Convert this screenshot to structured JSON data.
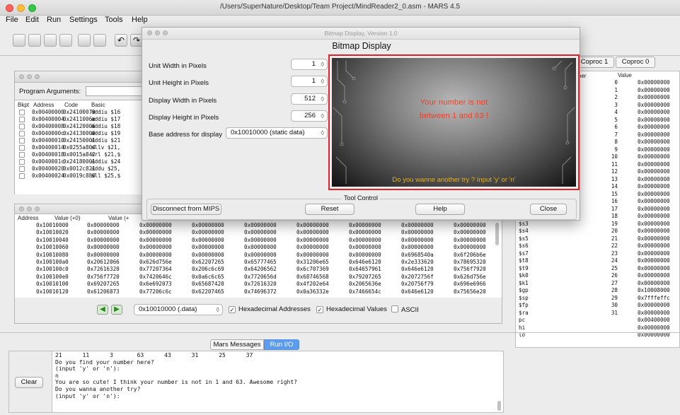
{
  "window": {
    "title": "/Users/SuperNature/Desktop/Team Project/MindReader2_0.asm - MARS 4.5"
  },
  "menu": [
    "File",
    "Edit",
    "Run",
    "Settings",
    "Tools",
    "Help"
  ],
  "bitmap": {
    "window_title": "Bitmap Display, Version 1.0",
    "heading": "Bitmap Display",
    "unit_width_label": "Unit Width in Pixels",
    "unit_width_value": "1",
    "unit_height_label": "Unit Height in Pixels",
    "unit_height_value": "1",
    "display_width_label": "Display Width in Pixels",
    "display_width_value": "512",
    "display_height_label": "Display Height in Pixels",
    "display_height_value": "256",
    "base_label": "Base address for display",
    "base_value": "0x10010000 (static data)",
    "message_line1": "Your number is not",
    "message_line2": "between 1 and 63 !",
    "prompt": "Do you wanne another try ? Input 'y' or 'n'",
    "tool_control": "Tool Control",
    "disconnect": "Disconnect from MIPS",
    "reset": "Reset",
    "help": "Help",
    "close": "Close",
    "accent_color": "#d9242a"
  },
  "text_segment": {
    "program_args_label": "Program Arguments:",
    "headers": [
      "Bkpt",
      "Address",
      "Code",
      "Basic"
    ],
    "rows": [
      [
        "0x00400000",
        "0x24100079",
        "addiu $16"
      ],
      [
        "0x00400004",
        "0x2411006e",
        "addiu $17"
      ],
      [
        "0x00400008",
        "0x24120006",
        "addiu $18"
      ],
      [
        "0x0040000c",
        "0x24130000",
        "addiu $19"
      ],
      [
        "0x00400010",
        "0x24150001",
        "addiu $21"
      ],
      [
        "0x00400014",
        "0x0255a804",
        "sllv $21,"
      ],
      [
        "0x00400018",
        "0x0015a842",
        "srl $21,$"
      ],
      [
        "0x0040001c",
        "0x24180001",
        "addiu $24"
      ],
      [
        "0x00400020",
        "0x0012c821",
        "addu $25,"
      ],
      [
        "0x00400024",
        "0x0019c880",
        "sll $25,$"
      ]
    ]
  },
  "data_segment": {
    "headers": [
      "Address",
      "Value (+0)",
      "Value (+"
    ],
    "rows": [
      [
        "0x10010000",
        "0x00000000",
        "0x00000000",
        "0x00000000",
        "0x00000000",
        "0x00000000",
        "0x00000000",
        "0x00000000",
        "0x00000000"
      ],
      [
        "0x10010020",
        "0x00000000",
        "0x00000000",
        "0x00000000",
        "0x00000000",
        "0x00000000",
        "0x00000000",
        "0x00000000",
        "0x00000000"
      ],
      [
        "0x10010040",
        "0x00000000",
        "0x00000000",
        "0x00000000",
        "0x00000000",
        "0x00000000",
        "0x00000000",
        "0x00000000",
        "0x00000000"
      ],
      [
        "0x10010060",
        "0x00000000",
        "0x00000000",
        "0x00000000",
        "0x00000000",
        "0x00000000",
        "0x00000000",
        "0x00000000",
        "0x00000000"
      ],
      [
        "0x10010080",
        "0x00000000",
        "0x00000000",
        "0x00000000",
        "0x00000000",
        "0x00000000",
        "0x00000000",
        "0x6968540a",
        "0x6f206b6e"
      ],
      [
        "0x100100a0",
        "0x20612066",
        "0x626d756e",
        "0x62207265",
        "0x65777465",
        "0x31206e65",
        "0x646e6120",
        "0x2e333620",
        "0x78695320"
      ],
      [
        "0x100100c0",
        "0x72616320",
        "0x77207364",
        "0x206c6c69",
        "0x64206562",
        "0x6c707369",
        "0x64657961",
        "0x646e6120",
        "0x756f7920"
      ],
      [
        "0x100100e0",
        "0x756f7720",
        "0x7420646c",
        "0x0a6c6c65",
        "0x7720656d",
        "0x68746568",
        "0x79207265",
        "0x2072756f",
        "0x626d756e"
      ],
      [
        "0x10010100",
        "0x69207265",
        "0x6e692073",
        "0x65687420",
        "0x72616320",
        "0x4f202e64",
        "0x2065636e",
        "0x20756f79",
        "0x696e6966"
      ],
      [
        "0x10010120",
        "0x61206873",
        "0x77206c6c",
        "0x62207465",
        "0x74696372",
        "0x0a36332e",
        "0x7466654c",
        "0x646e6120",
        "0x75656e20"
      ]
    ],
    "address_select": "0x10010000 (.data)",
    "hex_addresses": "Hexadecimal Addresses",
    "hex_values": "Hexadecimal Values",
    "ascii": "ASCII"
  },
  "registers": {
    "tabs": [
      "Coproc 1",
      "Coproc 0"
    ],
    "headers": [
      "ber",
      "Value"
    ],
    "rows": [
      [
        "",
        "0",
        "0x00000000"
      ],
      [
        "",
        "1",
        "0x00000000"
      ],
      [
        "",
        "2",
        "0x00000000"
      ],
      [
        "",
        "3",
        "0x00000000"
      ],
      [
        "",
        "4",
        "0x00000000"
      ],
      [
        "",
        "5",
        "0x00000000"
      ],
      [
        "",
        "6",
        "0x00000000"
      ],
      [
        "",
        "7",
        "0x00000000"
      ],
      [
        "",
        "8",
        "0x00000000"
      ],
      [
        "",
        "9",
        "0x00000000"
      ],
      [
        "",
        "10",
        "0x00000000"
      ],
      [
        "",
        "11",
        "0x00000000"
      ],
      [
        "",
        "12",
        "0x00000000"
      ],
      [
        "",
        "13",
        "0x00000000"
      ],
      [
        "",
        "14",
        "0x00000000"
      ],
      [
        "",
        "15",
        "0x00000000"
      ],
      [
        "",
        "16",
        "0x00000000"
      ],
      [
        "",
        "17",
        "0x00000000"
      ],
      [
        "",
        "18",
        "0x00000000"
      ],
      [
        "$s3",
        "19",
        "0x00000000"
      ],
      [
        "$s4",
        "20",
        "0x00000000"
      ],
      [
        "$s5",
        "21",
        "0x00000000"
      ],
      [
        "$s6",
        "22",
        "0x00000000"
      ],
      [
        "$s7",
        "23",
        "0x00000000"
      ],
      [
        "$t8",
        "24",
        "0x00000000"
      ],
      [
        "$t9",
        "25",
        "0x00000000"
      ],
      [
        "$k0",
        "26",
        "0x00000000"
      ],
      [
        "$k1",
        "27",
        "0x00000000"
      ],
      [
        "$gp",
        "28",
        "0x10008000"
      ],
      [
        "$sp",
        "29",
        "0x7fffeffc"
      ],
      [
        "$fp",
        "30",
        "0x00000000"
      ],
      [
        "$ra",
        "31",
        "0x00000000"
      ],
      [
        "pc",
        "",
        "0x00400000"
      ],
      [
        "hi",
        "",
        "0x00000000"
      ],
      [
        "lo",
        "",
        "0x00000000"
      ]
    ]
  },
  "console": {
    "tabs": [
      "Mars Messages",
      "Run I/O"
    ],
    "clear": "Clear",
    "lines": [
      "21      11      3       63      43      31      25      37",
      "Do you find your number here?",
      "(input 'y' or 'n'):",
      "n",
      "You are so cute! I think your number is not in 1 and 63. Awesome right?",
      "Do you wanna another try?",
      "(input 'y' or 'n'):"
    ]
  }
}
